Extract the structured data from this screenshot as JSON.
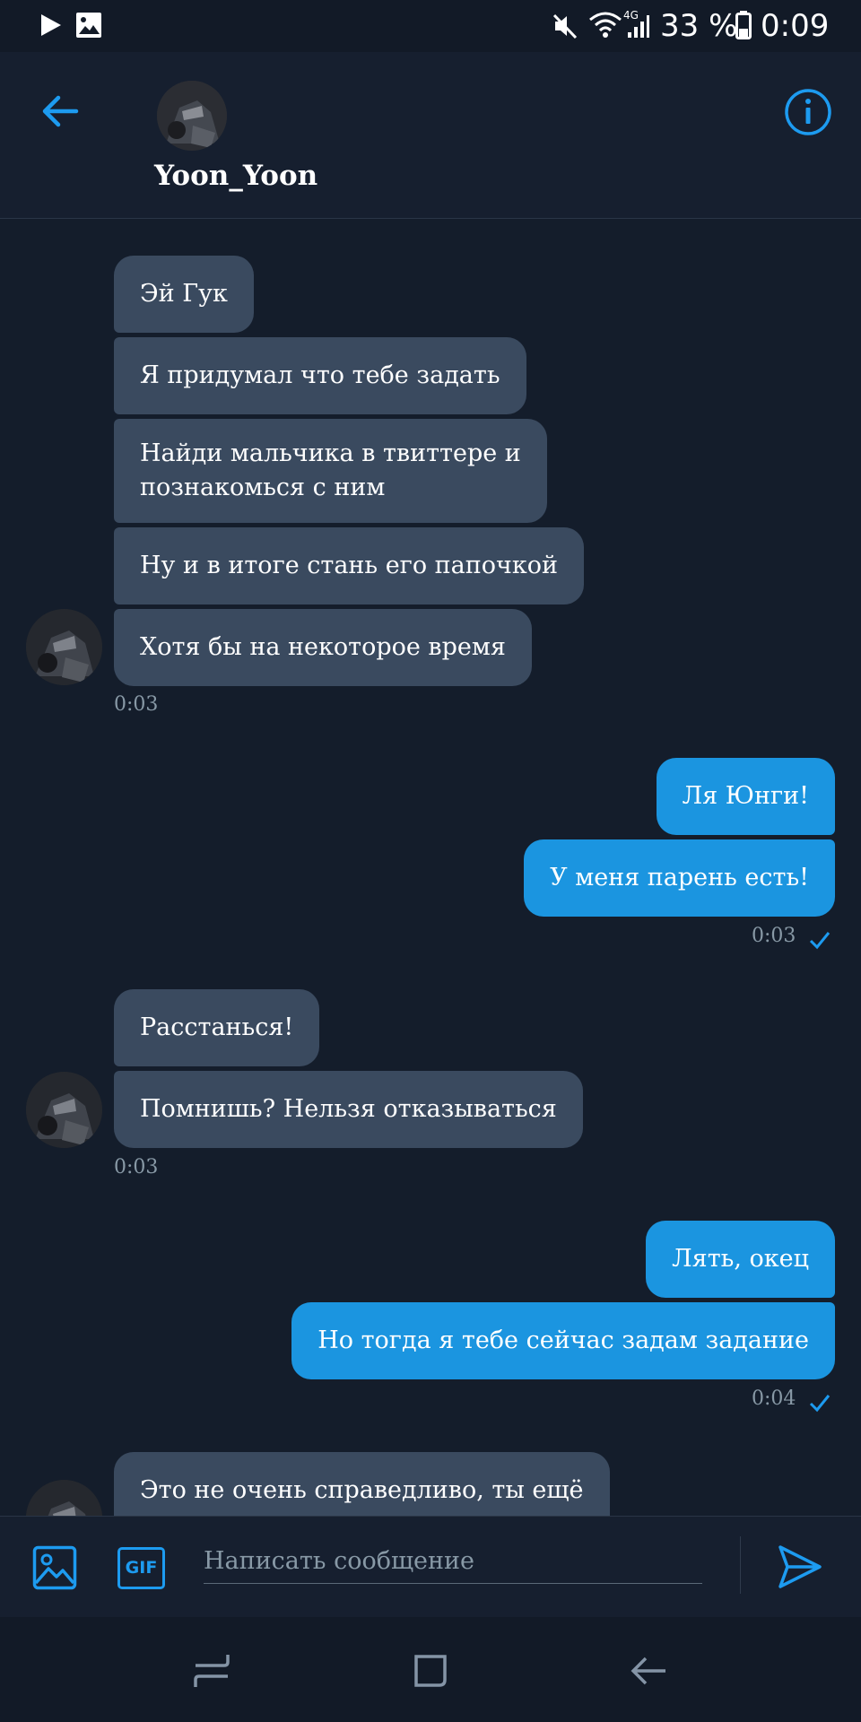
{
  "status": {
    "battery": "33 %",
    "time": "0:09",
    "network": "4G"
  },
  "header": {
    "username": "Yoon_Yoon",
    "back_icon": "back-arrow-icon",
    "info_icon": "info-icon"
  },
  "messages": [
    {
      "dir": "in",
      "text": "Эй Гук"
    },
    {
      "dir": "in",
      "text": "Я придумал что тебе задать"
    },
    {
      "dir": "in",
      "line1": "Найди мальчика в твиттере и",
      "line2": "познакомься с ним"
    },
    {
      "dir": "in",
      "text": "Ну и в итоге стань его папочкой"
    },
    {
      "dir": "in",
      "text": "Хотя бы на некоторое время"
    },
    {
      "dir": "out",
      "text": "Ля Юнги!"
    },
    {
      "dir": "out",
      "text": "У меня парень есть!"
    },
    {
      "dir": "in",
      "text": "Расстанься!"
    },
    {
      "dir": "in",
      "text": "Помнишь? Нельзя отказываться"
    },
    {
      "dir": "out",
      "text": "Лять, окец"
    },
    {
      "dir": "out",
      "text": "Но тогда я тебе сейчас задам задание"
    },
    {
      "dir": "in",
      "text": "Это не очень справедливо, ты ещё"
    }
  ],
  "timestamps": [
    "0:03",
    "0:03",
    "0:03",
    "0:04"
  ],
  "composer": {
    "placeholder": "Написать сообщение",
    "gif_label": "GIF"
  },
  "colors": {
    "accent": "#1b95e0",
    "incoming_bubble": "#3a4a5f",
    "background": "#141d2b",
    "muted": "#8899a6"
  }
}
